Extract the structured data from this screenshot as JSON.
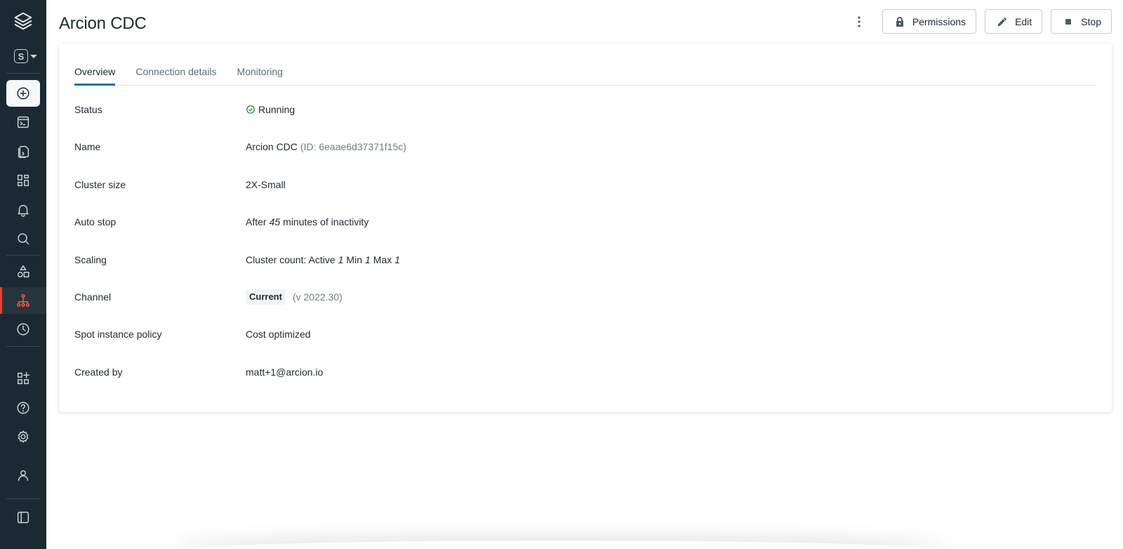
{
  "app": {
    "page_title": "Arcion CDC",
    "accent_color": "#2270b8",
    "active_indicator_color": "#ff3621"
  },
  "sidebar": {
    "workspace_badge": "S",
    "items": [
      {
        "name": "new",
        "icon": "plus-circle-icon"
      },
      {
        "name": "sql-editor",
        "icon": "terminal-window-icon"
      },
      {
        "name": "queries",
        "icon": "files-icon"
      },
      {
        "name": "dashboards",
        "icon": "dashboard-icon"
      },
      {
        "name": "alerts",
        "icon": "bell-icon"
      },
      {
        "name": "search",
        "icon": "search-icon"
      },
      {
        "name": "data",
        "icon": "shapes-icon"
      },
      {
        "name": "sql-warehouses",
        "icon": "hierarchy-icon"
      },
      {
        "name": "query-history",
        "icon": "clock-icon"
      },
      {
        "name": "partner-connect",
        "icon": "apps-plus-icon"
      },
      {
        "name": "help",
        "icon": "help-circle-icon"
      },
      {
        "name": "settings",
        "icon": "gear-icon"
      },
      {
        "name": "user",
        "icon": "user-icon"
      },
      {
        "name": "collapse",
        "icon": "sidebar-collapse-icon"
      }
    ]
  },
  "header": {
    "more_icon": "kebab-icon",
    "permissions_label": "Permissions",
    "edit_label": "Edit",
    "stop_label": "Stop"
  },
  "tabs": [
    {
      "label": "Overview",
      "active": true
    },
    {
      "label": "Connection details",
      "active": false
    },
    {
      "label": "Monitoring",
      "active": false
    }
  ],
  "details": {
    "status": {
      "label": "Status",
      "value": "Running",
      "color": "#2e8540"
    },
    "name": {
      "label": "Name",
      "value": "Arcion CDC",
      "id": "(ID: 6eaae6d37371f15c)"
    },
    "cluster_size": {
      "label": "Cluster size",
      "value": "2X-Small"
    },
    "auto_stop": {
      "label": "Auto stop",
      "prefix": "After",
      "minutes": "45",
      "suffix": "minutes of inactivity"
    },
    "scaling": {
      "label": "Scaling",
      "prefix": "Cluster count: Active",
      "active": "1",
      "min_label": "Min",
      "min": "1",
      "max_label": "Max",
      "max": "1"
    },
    "channel": {
      "label": "Channel",
      "chip": "Current",
      "version": "(v 2022.30)"
    },
    "spot_policy": {
      "label": "Spot instance policy",
      "value": "Cost optimized"
    },
    "created_by": {
      "label": "Created by",
      "value": "matt+1@arcion.io"
    }
  }
}
